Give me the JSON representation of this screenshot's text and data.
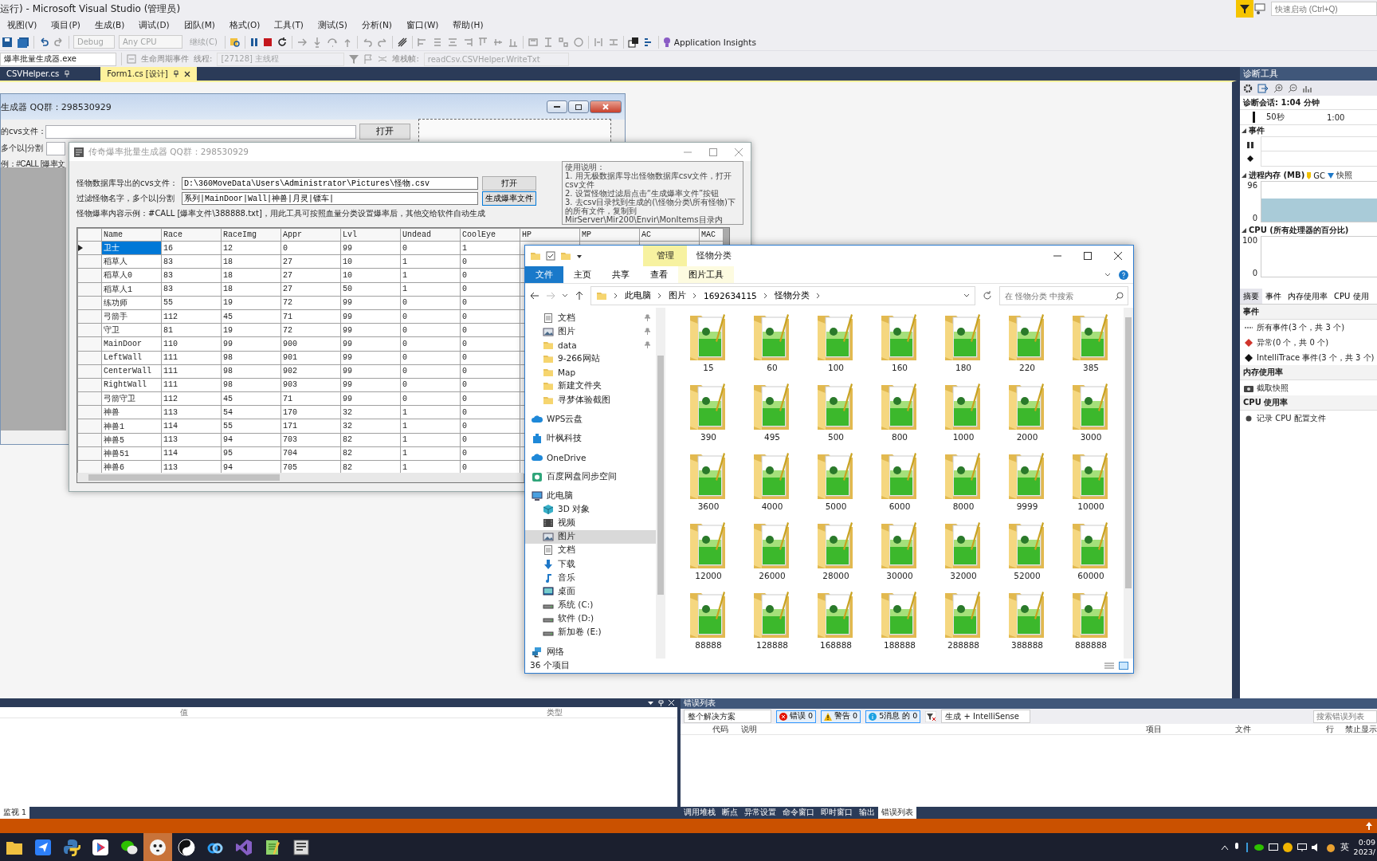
{
  "vs_window": {
    "title": "运行) - Microsoft Visual Studio (管理员)",
    "quick_launch": {
      "placeholder": "快速启动 (Ctrl+Q)"
    }
  },
  "menu": [
    "视图(V)",
    "项目(P)",
    "生成(B)",
    "调试(D)",
    "团队(M)",
    "格式(O)",
    "工具(T)",
    "测试(S)",
    "分析(N)",
    "窗口(W)",
    "帮助(H)"
  ],
  "toolbar": {
    "configuration": {
      "value": "Debug",
      "disabled": true
    },
    "platform": {
      "value": "Any CPU",
      "disabled": true
    },
    "continue": {
      "label": "继续(C)",
      "disabled": true
    },
    "insights": "Application Insights"
  },
  "debug_bar": {
    "process": "爆率批量生成器.exe",
    "lifecycle": "生命周期事件",
    "thread_label": "线程:",
    "thread": "[27128] 主线程",
    "stack_label": "堆栈帧:",
    "stack_frame": "readCsv.CSVHelper.WriteTxt"
  },
  "document_tabs": [
    {
      "label": "CSVHelper.cs",
      "selected": false
    },
    {
      "label": "Form1.cs [设计]",
      "selected": true
    }
  ],
  "designer_form": {
    "title": "生成器  QQ群：298530929",
    "csv_label": "的cvs文件：",
    "open_button": "打开",
    "filter_label": "多个以|分割",
    "example": "例：#CALL [爆率文"
  },
  "app_form": {
    "title": "传奇爆率批量生成器  QQ群：298530929",
    "csv_label": "怪物数据库导出的cvs文件：",
    "csv_path": "D:\\360MoveData\\Users\\Administrator\\Pictures\\怪物.csv",
    "open_button": "打开",
    "filter_label": "过滤怪物名字，多个以|分割",
    "filter_value": "系列|MainDoor|Wall|神兽|月灵|镖车|",
    "generate_button": "生成爆率文件",
    "example": "怪物爆率内容示例：#CALL [爆率文件\\388888.txt]，用此工具可按照血量分类设置爆率后，其他交给软件自动生成",
    "instructions": [
      "使用说明：",
      "1. 用无极数据库导出怪物数据库csv文件，打开csv文件",
      "2. 设置怪物过滤后点击“生成爆率文件”按钮",
      "3. 去csv目录找到生成的(\\怪物分类\\所有怪物)下的所有文件，复制到MirServer\\Mir200\\Envir\\MonItems目录内"
    ],
    "columns": [
      "Name",
      "Race",
      "RaceImg",
      "Appr",
      "Lvl",
      "Undead",
      "CoolEye",
      "HP",
      "MP",
      "AC",
      "MAC"
    ],
    "rows": [
      {
        "selected": true,
        "cells": [
          "卫士",
          "16",
          "12",
          "0",
          "99",
          "0",
          "1"
        ]
      },
      {
        "selected": false,
        "cells": [
          "稻草人",
          "83",
          "18",
          "27",
          "10",
          "1",
          "0"
        ]
      },
      {
        "selected": false,
        "cells": [
          "稻草人0",
          "83",
          "18",
          "27",
          "10",
          "1",
          "0"
        ]
      },
      {
        "selected": false,
        "cells": [
          "稻草人1",
          "83",
          "18",
          "27",
          "50",
          "1",
          "0"
        ]
      },
      {
        "selected": false,
        "cells": [
          "练功师",
          "55",
          "19",
          "72",
          "99",
          "0",
          "0"
        ]
      },
      {
        "selected": false,
        "cells": [
          "弓箭手",
          "112",
          "45",
          "71",
          "99",
          "0",
          "0"
        ]
      },
      {
        "selected": false,
        "cells": [
          "守卫",
          "81",
          "19",
          "72",
          "99",
          "0",
          "0"
        ]
      },
      {
        "selected": false,
        "cells": [
          "MainDoor",
          "110",
          "99",
          "900",
          "99",
          "0",
          "0"
        ]
      },
      {
        "selected": false,
        "cells": [
          "LeftWall",
          "111",
          "98",
          "901",
          "99",
          "0",
          "0"
        ]
      },
      {
        "selected": false,
        "cells": [
          "CenterWall",
          "111",
          "98",
          "902",
          "99",
          "0",
          "0"
        ]
      },
      {
        "selected": false,
        "cells": [
          "RightWall",
          "111",
          "98",
          "903",
          "99",
          "0",
          "0"
        ]
      },
      {
        "selected": false,
        "cells": [
          "弓箭守卫",
          "112",
          "45",
          "71",
          "99",
          "0",
          "0"
        ]
      },
      {
        "selected": false,
        "cells": [
          "神兽",
          "113",
          "54",
          "170",
          "32",
          "1",
          "0"
        ]
      },
      {
        "selected": false,
        "cells": [
          "神兽1",
          "114",
          "55",
          "171",
          "32",
          "1",
          "0"
        ]
      },
      {
        "selected": false,
        "cells": [
          "神兽5",
          "113",
          "94",
          "703",
          "82",
          "1",
          "0"
        ]
      },
      {
        "selected": false,
        "cells": [
          "神兽51",
          "114",
          "95",
          "704",
          "82",
          "1",
          "0"
        ]
      },
      {
        "selected": false,
        "cells": [
          "神兽6",
          "113",
          "94",
          "705",
          "82",
          "1",
          "0"
        ]
      }
    ]
  },
  "explorer": {
    "title": "怪物分类",
    "context_tab": "管理",
    "ribbon_tabs": [
      {
        "label": "文件",
        "selected": true
      },
      {
        "label": "主页",
        "selected": false
      },
      {
        "label": "共享",
        "selected": false
      },
      {
        "label": "查看",
        "selected": false
      },
      {
        "label": "图片工具",
        "selected": false
      }
    ],
    "breadcrumb": [
      "此电脑",
      "图片",
      "1692634115",
      "怪物分类"
    ],
    "search": {
      "placeholder": "在 怪物分类 中搜索"
    },
    "quick_access": [
      {
        "label": "文档",
        "kind": "doc",
        "pinned": true,
        "selected": false
      },
      {
        "label": "图片",
        "kind": "pictures",
        "pinned": true,
        "selected": false
      },
      {
        "label": "data",
        "kind": "folder",
        "pinned": true,
        "selected": false
      },
      {
        "label": "9-266网站",
        "kind": "folder",
        "pinned": false,
        "selected": false
      },
      {
        "label": "Map",
        "kind": "folder",
        "pinned": false,
        "selected": false
      },
      {
        "label": "新建文件夹",
        "kind": "folder",
        "pinned": false,
        "selected": false
      },
      {
        "label": "寻梦体验截图",
        "kind": "folder",
        "pinned": false,
        "selected": false
      }
    ],
    "locations": [
      {
        "label": "WPS云盘",
        "kind": "cloud",
        "selected": false
      },
      {
        "label": "叶枫科技",
        "kind": "team",
        "selected": false
      },
      {
        "label": "OneDrive",
        "kind": "cloud",
        "selected": false
      },
      {
        "label": "百度网盘同步空间",
        "kind": "sync",
        "selected": false
      },
      {
        "label": "此电脑",
        "kind": "pc",
        "selected": false,
        "children": [
          {
            "label": "3D 对象",
            "kind": "cube",
            "selected": false
          },
          {
            "label": "视频",
            "kind": "video",
            "selected": false
          },
          {
            "label": "图片",
            "kind": "pictures",
            "selected": true
          },
          {
            "label": "文档",
            "kind": "doc",
            "selected": false
          },
          {
            "label": "下载",
            "kind": "download",
            "selected": false
          },
          {
            "label": "音乐",
            "kind": "music",
            "selected": false
          },
          {
            "label": "桌面",
            "kind": "desktop",
            "selected": false
          },
          {
            "label": "系统 (C:)",
            "kind": "drive",
            "selected": false
          },
          {
            "label": "软件 (D:)",
            "kind": "drive",
            "selected": false
          },
          {
            "label": "新加卷 (E:)",
            "kind": "drive",
            "selected": false
          }
        ]
      },
      {
        "label": "网络",
        "kind": "network",
        "selected": false
      }
    ],
    "folders": [
      {
        "name": "15",
        "selected": false
      },
      {
        "name": "60",
        "selected": false
      },
      {
        "name": "100",
        "selected": false
      },
      {
        "name": "160",
        "selected": false
      },
      {
        "name": "180",
        "selected": false
      },
      {
        "name": "220",
        "selected": false
      },
      {
        "name": "385",
        "selected": false
      },
      {
        "name": "390",
        "selected": false
      },
      {
        "name": "495",
        "selected": false
      },
      {
        "name": "500",
        "selected": false
      },
      {
        "name": "800",
        "selected": false
      },
      {
        "name": "1000",
        "selected": false
      },
      {
        "name": "2000",
        "selected": false
      },
      {
        "name": "3000",
        "selected": false
      },
      {
        "name": "3600",
        "selected": false
      },
      {
        "name": "4000",
        "selected": false
      },
      {
        "name": "5000",
        "selected": false
      },
      {
        "name": "6000",
        "selected": false
      },
      {
        "name": "8000",
        "selected": false
      },
      {
        "name": "9999",
        "selected": false
      },
      {
        "name": "10000",
        "selected": false
      },
      {
        "name": "12000",
        "selected": false
      },
      {
        "name": "26000",
        "selected": false
      },
      {
        "name": "28000",
        "selected": false
      },
      {
        "name": "30000",
        "selected": false
      },
      {
        "name": "32000",
        "selected": false
      },
      {
        "name": "52000",
        "selected": false
      },
      {
        "name": "60000",
        "selected": false
      },
      {
        "name": "88888",
        "selected": false
      },
      {
        "name": "128888",
        "selected": false
      },
      {
        "name": "168888",
        "selected": false
      },
      {
        "name": "188888",
        "selected": false
      },
      {
        "name": "288888",
        "selected": false
      },
      {
        "name": "388888",
        "selected": false
      },
      {
        "name": "888888",
        "selected": false
      }
    ],
    "status": "36 个项目"
  },
  "diagnostics": {
    "title": "诊断工具",
    "session": "诊断会话: 1:04 分钟",
    "timeline": [
      "50秒",
      "1:00"
    ],
    "events_label": "事件",
    "memory_label": "进程内存 (MB)",
    "gc": "GC",
    "snapshot": "快照",
    "memory_ticks": [
      "96",
      "0"
    ],
    "cpu_label": "CPU (所有处理器的百分比)",
    "cpu_ticks": [
      "100",
      "0"
    ],
    "tabs": [
      {
        "label": "摘要",
        "selected": true
      },
      {
        "label": "事件",
        "selected": false
      },
      {
        "label": "内存使用率",
        "selected": false
      },
      {
        "label": "CPU 使用",
        "selected": false
      }
    ],
    "sections": [
      {
        "title": "事件",
        "items": [
          {
            "label": "所有事件(3 个，共 3 个)",
            "kind": "all"
          },
          {
            "label": "异常(0 个，共 0 个)",
            "kind": "exception"
          },
          {
            "label": "IntelliTrace 事件(3 个，共 3 个)",
            "kind": "intellitrace"
          }
        ]
      },
      {
        "title": "内存使用率",
        "items": [
          {
            "label": "截取快照",
            "kind": "snapshot"
          }
        ]
      },
      {
        "title": "CPU 使用率",
        "items": [
          {
            "label": "记录 CPU 配置文件",
            "kind": "record"
          }
        ]
      }
    ]
  },
  "watch": {
    "columns": [
      "值",
      "类型"
    ],
    "tab": "监视 1"
  },
  "error_list": {
    "title": "错误列表",
    "scope": "整个解决方案",
    "filters": [
      {
        "label": "错误 0",
        "kind": "error",
        "selected": true
      },
      {
        "label": "警告 0",
        "kind": "warning",
        "selected": true
      },
      {
        "label": "5消息 的 0",
        "kind": "info",
        "selected": true
      }
    ],
    "source": "生成 + IntelliSense",
    "search": {
      "placeholder": "搜索错误列表"
    },
    "columns": [
      "代码",
      "说明",
      "项目",
      "文件",
      "行",
      "禁止显示"
    ]
  },
  "bottom_tabs": [
    {
      "label": "调用堆栈",
      "selected": false
    },
    {
      "label": "断点",
      "selected": false
    },
    {
      "label": "异常设置",
      "selected": false
    },
    {
      "label": "命令窗口",
      "selected": false
    },
    {
      "label": "即时窗口",
      "selected": false
    },
    {
      "label": "输出",
      "selected": false
    },
    {
      "label": "错误列表",
      "selected": true
    }
  ],
  "taskbar": {
    "apps": [
      {
        "kind": "folder",
        "selected": false
      },
      {
        "kind": "mail",
        "selected": false
      },
      {
        "kind": "python",
        "selected": false
      },
      {
        "kind": "video",
        "selected": false
      },
      {
        "kind": "chat",
        "selected": false
      },
      {
        "kind": "avatar",
        "selected": true
      },
      {
        "kind": "yinyang",
        "selected": false
      },
      {
        "kind": "cloud",
        "selected": false
      },
      {
        "kind": "vs",
        "selected": false
      },
      {
        "kind": "notepad",
        "selected": false
      },
      {
        "kind": "app",
        "selected": false
      }
    ],
    "ime": "英",
    "time": "0:09",
    "date": "2023/"
  }
}
